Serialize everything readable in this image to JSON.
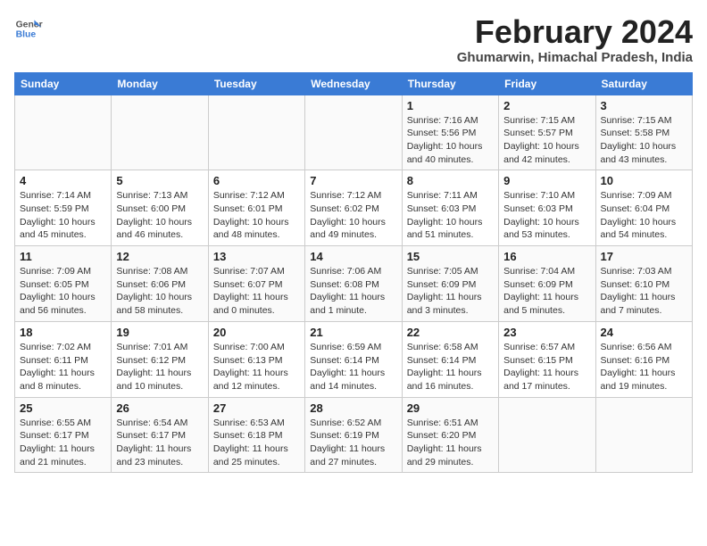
{
  "header": {
    "logo_line1": "General",
    "logo_line2": "Blue",
    "month_year": "February 2024",
    "location": "Ghumarwin, Himachal Pradesh, India"
  },
  "weekdays": [
    "Sunday",
    "Monday",
    "Tuesday",
    "Wednesday",
    "Thursday",
    "Friday",
    "Saturday"
  ],
  "weeks": [
    [
      {
        "day": "",
        "info": ""
      },
      {
        "day": "",
        "info": ""
      },
      {
        "day": "",
        "info": ""
      },
      {
        "day": "",
        "info": ""
      },
      {
        "day": "1",
        "info": "Sunrise: 7:16 AM\nSunset: 5:56 PM\nDaylight: 10 hours\nand 40 minutes."
      },
      {
        "day": "2",
        "info": "Sunrise: 7:15 AM\nSunset: 5:57 PM\nDaylight: 10 hours\nand 42 minutes."
      },
      {
        "day": "3",
        "info": "Sunrise: 7:15 AM\nSunset: 5:58 PM\nDaylight: 10 hours\nand 43 minutes."
      }
    ],
    [
      {
        "day": "4",
        "info": "Sunrise: 7:14 AM\nSunset: 5:59 PM\nDaylight: 10 hours\nand 45 minutes."
      },
      {
        "day": "5",
        "info": "Sunrise: 7:13 AM\nSunset: 6:00 PM\nDaylight: 10 hours\nand 46 minutes."
      },
      {
        "day": "6",
        "info": "Sunrise: 7:12 AM\nSunset: 6:01 PM\nDaylight: 10 hours\nand 48 minutes."
      },
      {
        "day": "7",
        "info": "Sunrise: 7:12 AM\nSunset: 6:02 PM\nDaylight: 10 hours\nand 49 minutes."
      },
      {
        "day": "8",
        "info": "Sunrise: 7:11 AM\nSunset: 6:03 PM\nDaylight: 10 hours\nand 51 minutes."
      },
      {
        "day": "9",
        "info": "Sunrise: 7:10 AM\nSunset: 6:03 PM\nDaylight: 10 hours\nand 53 minutes."
      },
      {
        "day": "10",
        "info": "Sunrise: 7:09 AM\nSunset: 6:04 PM\nDaylight: 10 hours\nand 54 minutes."
      }
    ],
    [
      {
        "day": "11",
        "info": "Sunrise: 7:09 AM\nSunset: 6:05 PM\nDaylight: 10 hours\nand 56 minutes."
      },
      {
        "day": "12",
        "info": "Sunrise: 7:08 AM\nSunset: 6:06 PM\nDaylight: 10 hours\nand 58 minutes."
      },
      {
        "day": "13",
        "info": "Sunrise: 7:07 AM\nSunset: 6:07 PM\nDaylight: 11 hours\nand 0 minutes."
      },
      {
        "day": "14",
        "info": "Sunrise: 7:06 AM\nSunset: 6:08 PM\nDaylight: 11 hours\nand 1 minute."
      },
      {
        "day": "15",
        "info": "Sunrise: 7:05 AM\nSunset: 6:09 PM\nDaylight: 11 hours\nand 3 minutes."
      },
      {
        "day": "16",
        "info": "Sunrise: 7:04 AM\nSunset: 6:09 PM\nDaylight: 11 hours\nand 5 minutes."
      },
      {
        "day": "17",
        "info": "Sunrise: 7:03 AM\nSunset: 6:10 PM\nDaylight: 11 hours\nand 7 minutes."
      }
    ],
    [
      {
        "day": "18",
        "info": "Sunrise: 7:02 AM\nSunset: 6:11 PM\nDaylight: 11 hours\nand 8 minutes."
      },
      {
        "day": "19",
        "info": "Sunrise: 7:01 AM\nSunset: 6:12 PM\nDaylight: 11 hours\nand 10 minutes."
      },
      {
        "day": "20",
        "info": "Sunrise: 7:00 AM\nSunset: 6:13 PM\nDaylight: 11 hours\nand 12 minutes."
      },
      {
        "day": "21",
        "info": "Sunrise: 6:59 AM\nSunset: 6:14 PM\nDaylight: 11 hours\nand 14 minutes."
      },
      {
        "day": "22",
        "info": "Sunrise: 6:58 AM\nSunset: 6:14 PM\nDaylight: 11 hours\nand 16 minutes."
      },
      {
        "day": "23",
        "info": "Sunrise: 6:57 AM\nSunset: 6:15 PM\nDaylight: 11 hours\nand 17 minutes."
      },
      {
        "day": "24",
        "info": "Sunrise: 6:56 AM\nSunset: 6:16 PM\nDaylight: 11 hours\nand 19 minutes."
      }
    ],
    [
      {
        "day": "25",
        "info": "Sunrise: 6:55 AM\nSunset: 6:17 PM\nDaylight: 11 hours\nand 21 minutes."
      },
      {
        "day": "26",
        "info": "Sunrise: 6:54 AM\nSunset: 6:17 PM\nDaylight: 11 hours\nand 23 minutes."
      },
      {
        "day": "27",
        "info": "Sunrise: 6:53 AM\nSunset: 6:18 PM\nDaylight: 11 hours\nand 25 minutes."
      },
      {
        "day": "28",
        "info": "Sunrise: 6:52 AM\nSunset: 6:19 PM\nDaylight: 11 hours\nand 27 minutes."
      },
      {
        "day": "29",
        "info": "Sunrise: 6:51 AM\nSunset: 6:20 PM\nDaylight: 11 hours\nand 29 minutes."
      },
      {
        "day": "",
        "info": ""
      },
      {
        "day": "",
        "info": ""
      }
    ]
  ]
}
